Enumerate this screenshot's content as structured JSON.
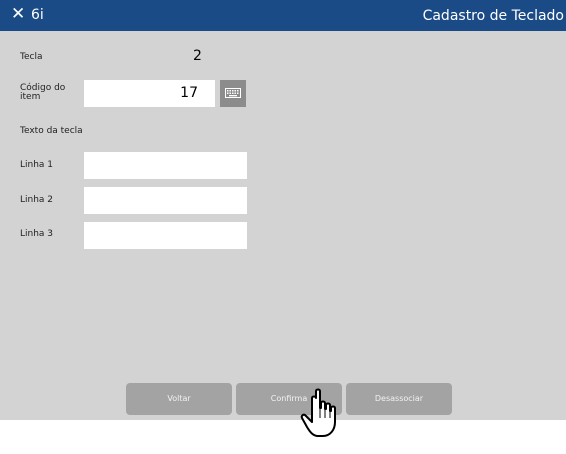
{
  "header": {
    "close_glyph": "✕",
    "app_code": "6i",
    "title": "Cadastro de Teclado"
  },
  "form": {
    "tecla_label": "Tecla",
    "tecla_value": "2",
    "codigo_label_line1": "Código do",
    "codigo_label_line2": "item",
    "codigo_value": "17",
    "texto_label": "Texto da tecla",
    "linha1_label": "Linha 1",
    "linha2_label": "Linha 2",
    "linha3_label": "Linha 3",
    "linha1_value": "",
    "linha2_value": "",
    "linha3_value": ""
  },
  "buttons": {
    "voltar": "Voltar",
    "confirma": "Confirma",
    "desassociar": "Desassociar"
  },
  "colors": {
    "header_bg": "#1b4b87",
    "panel_bg": "#d3d3d3",
    "button_bg": "#a3a3a3"
  },
  "icons": {
    "keyboard": "keyboard-icon",
    "close": "close-icon",
    "cursor": "hand-pointer-icon"
  }
}
